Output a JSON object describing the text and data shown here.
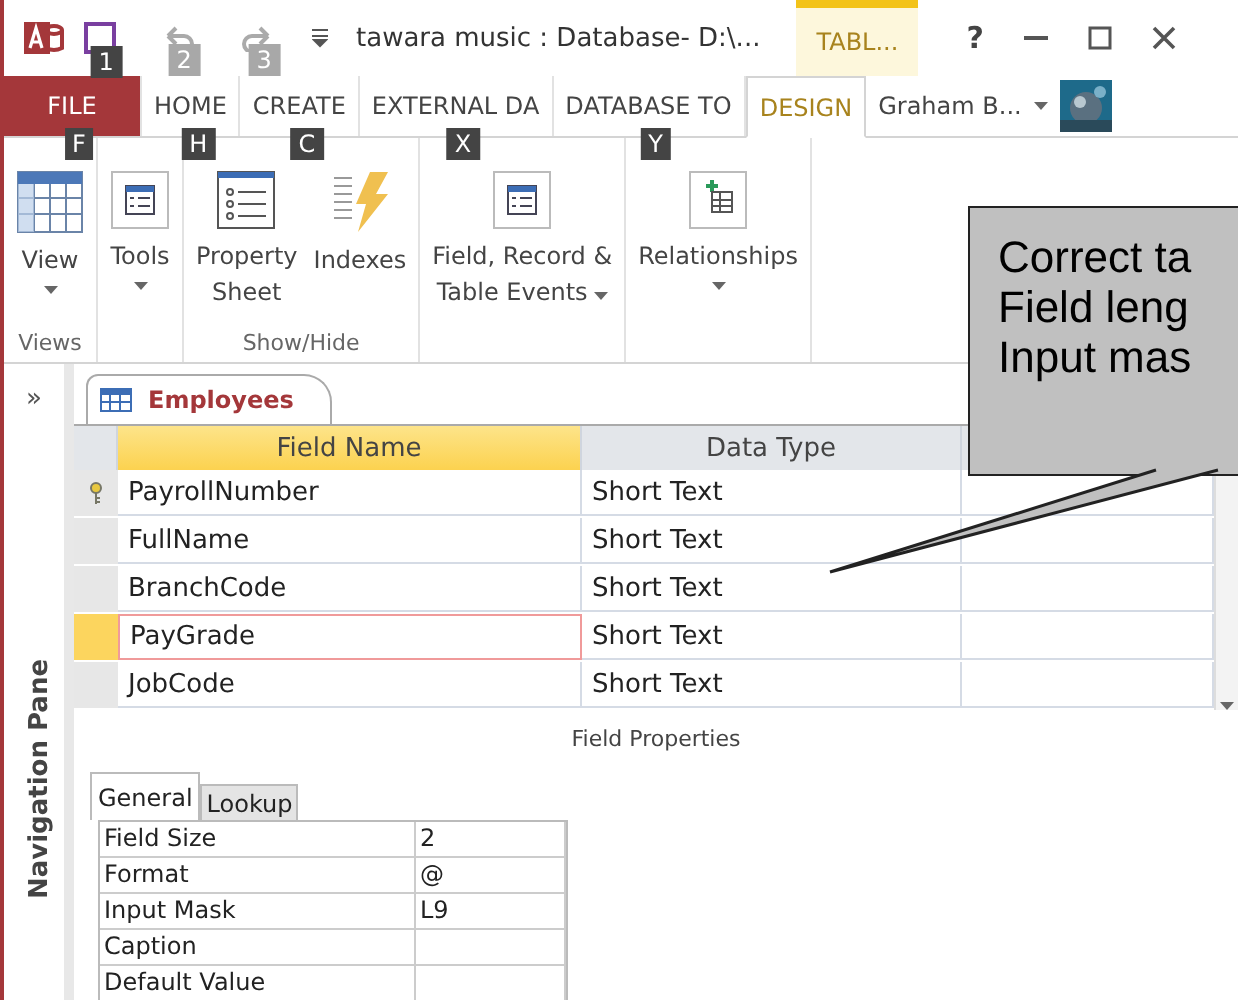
{
  "window": {
    "title": "tawara music : Database- D:\\...",
    "context_tab": "TABL...",
    "help": "?"
  },
  "quick_access": [
    {
      "kind": "save",
      "key_tip": "1",
      "disabled": false
    },
    {
      "kind": "undo",
      "key_tip": "2",
      "disabled": true
    },
    {
      "kind": "redo",
      "key_tip": "3",
      "disabled": true
    }
  ],
  "ribbon_tabs": [
    {
      "label": "FILE",
      "key_tip": "F",
      "kind": "file",
      "selected": false
    },
    {
      "label": "HOME",
      "key_tip": "H",
      "kind": "tab",
      "selected": false
    },
    {
      "label": "CREATE",
      "key_tip": "C",
      "kind": "tab",
      "selected": false
    },
    {
      "label": "EXTERNAL DA",
      "key_tip": "X",
      "kind": "tab",
      "selected": false
    },
    {
      "label": "DATABASE TO",
      "key_tip": "Y",
      "kind": "tab",
      "selected": false
    },
    {
      "label": "DESIGN",
      "kind": "tab",
      "selected": true
    }
  ],
  "account": {
    "name": "Graham B..."
  },
  "ribbon_groups": [
    {
      "label": "Views",
      "commands": [
        {
          "kind": "view",
          "lines": [
            "View"
          ],
          "dropdown": true
        }
      ]
    },
    {
      "commands": [
        {
          "kind": "form",
          "lines": [
            "Tools"
          ],
          "dropdown": true
        }
      ]
    },
    {
      "label": "Show/Hide",
      "commands": [
        {
          "kind": "sheet",
          "lines": [
            "Property",
            "Sheet"
          ],
          "dropdown": false
        },
        {
          "kind": "indexes",
          "lines": [
            "Indexes"
          ],
          "dropdown": false
        }
      ]
    },
    {
      "commands": [
        {
          "kind": "form",
          "lines": [
            "Field, Record &",
            "Table Events"
          ],
          "dropdown": true
        }
      ]
    },
    {
      "commands": [
        {
          "kind": "relations",
          "lines": [
            "Relationships"
          ],
          "dropdown": true
        }
      ]
    }
  ],
  "nav_pane": {
    "toggle": "»",
    "label": "Navigation Pane"
  },
  "document_tab": {
    "label": "Employees"
  },
  "fields": {
    "columns": [
      "Field Name",
      "Data Type"
    ],
    "rows": [
      {
        "name": "PayrollNumber",
        "type": "Short Text",
        "primary_key": true,
        "selected": false
      },
      {
        "name": "FullName",
        "type": "Short Text",
        "primary_key": false,
        "selected": false
      },
      {
        "name": "BranchCode",
        "type": "Short Text",
        "primary_key": false,
        "selected": false
      },
      {
        "name": "PayGrade",
        "type": "Short Text",
        "primary_key": false,
        "selected": true
      },
      {
        "name": "JobCode",
        "type": "Short Text",
        "primary_key": false,
        "selected": false
      }
    ]
  },
  "field_properties": {
    "title": "Field Properties",
    "tabs": [
      {
        "label": "General",
        "selected": true
      },
      {
        "label": "Lookup",
        "selected": false
      }
    ],
    "rows": [
      {
        "label": "Field Size",
        "value": "2"
      },
      {
        "label": "Format",
        "value": "@"
      },
      {
        "label": "Input Mask",
        "value": "L9"
      },
      {
        "label": "Caption"
      },
      {
        "label": "Default Value"
      }
    ]
  },
  "callout": {
    "lines": [
      "Correct ta",
      "Field leng",
      "Input mas"
    ]
  }
}
